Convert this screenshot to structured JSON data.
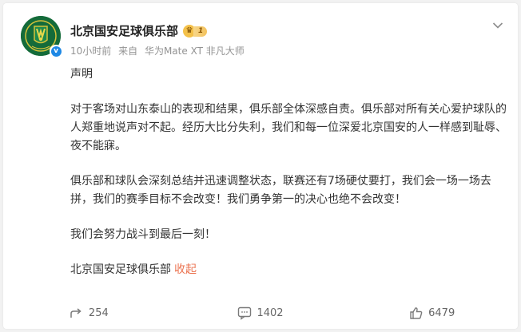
{
  "post": {
    "author": "北京国安足球俱乐部",
    "level_label": "1",
    "time": "10小时前",
    "source_prefix": "来自",
    "source_device": "华为Mate XT 非凡大师",
    "paragraphs": [
      "声明",
      "对于客场对山东泰山的表现和结果，俱乐部全体深感自责。俱乐部对所有关心爱护球队的人郑重地说声对不起。经历大比分失利，我们和每一位深爱北京国安的人一样感到耻辱、夜不能寐。",
      "俱乐部和球队会深刻总结并迅速调整状态，联赛还有7场硬仗要打，我们会一场一场去拼，我们的赛季目标不会改变！我们勇争第一的决心也绝不会改变！",
      "我们会努力战斗到最后一刻！"
    ],
    "signature": "北京国安足球俱乐部",
    "collapse_label": "收起"
  },
  "actions": {
    "share_count": "254",
    "comment_count": "1402",
    "like_count": "6479"
  },
  "icons": {
    "share": "share-icon",
    "comment": "comment-icon",
    "like": "like-icon",
    "more": "chevron-down-icon",
    "verified": "verified-badge-icon"
  },
  "colors": {
    "accent": "#eb7350",
    "brand_green": "#146b3a",
    "verified_blue": "#1e88e5"
  }
}
